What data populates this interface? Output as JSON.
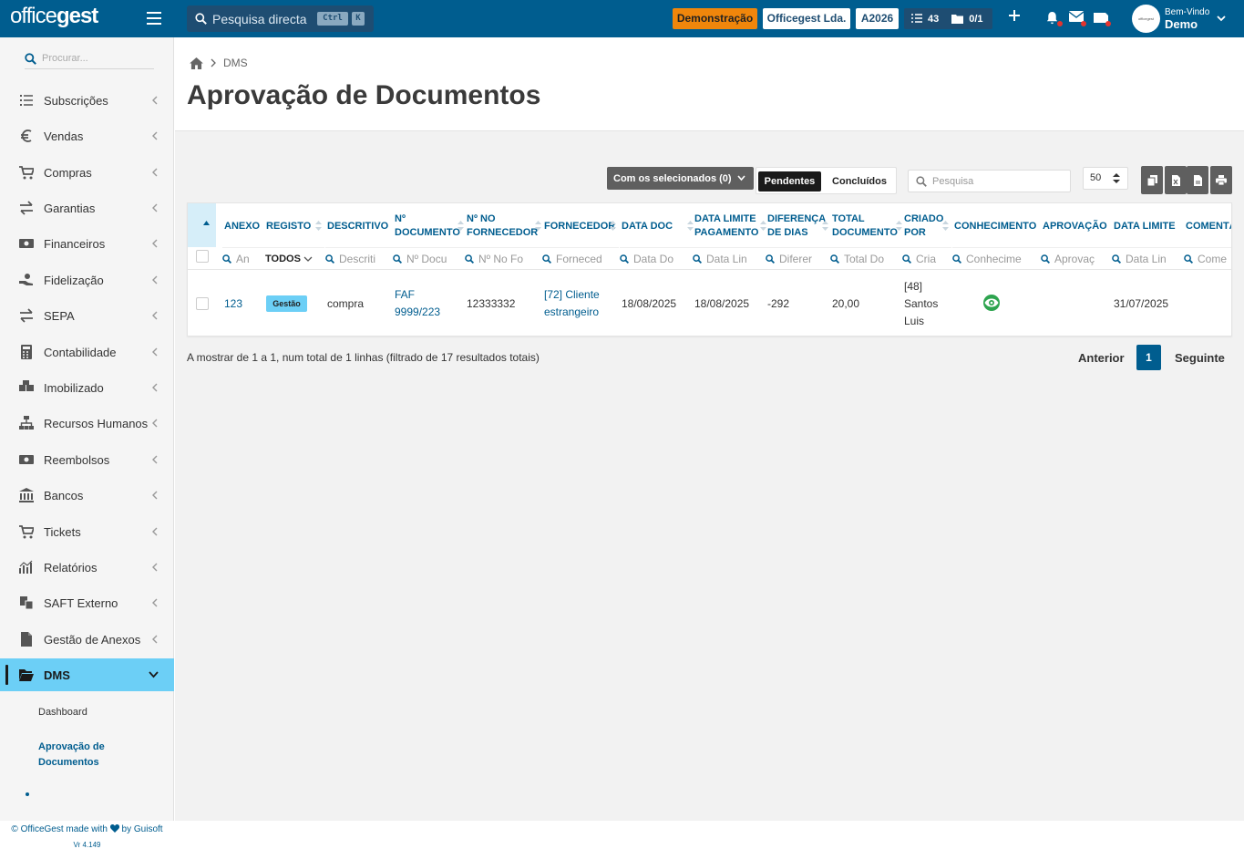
{
  "app": {
    "logo_prefix": "office",
    "logo_suffix": "gest"
  },
  "topbar": {
    "search_label": "Pesquisa directa",
    "kbd_ctrl": "Ctrl",
    "kbd_k": "K",
    "badge_demo": "Demonstração",
    "badge_company": "Officegest Lda.",
    "badge_year": "A2026",
    "tasks_count": "43",
    "folders_count": "0/1",
    "welcome": "Bem-Vindo",
    "user": "Demo",
    "colors": {
      "bar": "#005d8f",
      "demo_badge": "#f0860b",
      "notif_dot": "#e3342f"
    }
  },
  "sidebar": {
    "search_placeholder": "Procurar...",
    "items": [
      {
        "label": "Subscrições",
        "icon": "list-icon"
      },
      {
        "label": "Vendas",
        "icon": "euro-icon"
      },
      {
        "label": "Compras",
        "icon": "cart-icon"
      },
      {
        "label": "Garantias",
        "icon": "exchange-icon"
      },
      {
        "label": "Financeiros",
        "icon": "money-icon"
      },
      {
        "label": "Fidelização",
        "icon": "hand-coin-icon"
      },
      {
        "label": "SEPA",
        "icon": "exchange-icon"
      },
      {
        "label": "Contabilidade",
        "icon": "calculator-icon"
      },
      {
        "label": "Imobilizado",
        "icon": "boxes-icon"
      },
      {
        "label": "Recursos Humanos",
        "icon": "org-chart-icon"
      },
      {
        "label": "Reembolsos",
        "icon": "money-icon"
      },
      {
        "label": "Bancos",
        "icon": "bank-icon"
      },
      {
        "label": "Tickets",
        "icon": "cart-icon"
      },
      {
        "label": "Relatórios",
        "icon": "chart-icon"
      },
      {
        "label": "SAFT Externo",
        "icon": "saft-icon"
      },
      {
        "label": "Gestão de Anexos",
        "icon": "file-icon"
      },
      {
        "label": "DMS",
        "icon": "folder-open-icon"
      }
    ],
    "sub_items": [
      "Dashboard",
      "Aprovação de",
      "Documentos"
    ],
    "footer_prefix": "© OfficeGest made with",
    "footer_suffix": "by Guisoft",
    "version": "Vr 4.149",
    "active_color": "#6ccff6"
  },
  "page": {
    "breadcrumb": "DMS",
    "title": "Aprovação de Documentos"
  },
  "toolbar": {
    "bulk_label": "Com os selecionados (0)",
    "tab_pending": "Pendentes",
    "tab_done": "Concluídos",
    "search_placeholder": "Pesquisa",
    "page_size": "50"
  },
  "table": {
    "headers": [
      {
        "l1": "ANEXO",
        "l2": ""
      },
      {
        "l1": "REGISTO",
        "l2": ""
      },
      {
        "l1": "DESCRITIVO",
        "l2": ""
      },
      {
        "l1": "Nº",
        "l2": "DOCUMENTO"
      },
      {
        "l1": "Nº NO",
        "l2": "FORNECEDOR"
      },
      {
        "l1": "FORNECEDOR",
        "l2": ""
      },
      {
        "l1": "DATA DOC",
        "l2": ""
      },
      {
        "l1": "DATA LIMITE",
        "l2": "PAGAMENTO"
      },
      {
        "l1": "DIFERENÇA",
        "l2": "DE DIAS"
      },
      {
        "l1": "TOTAL",
        "l2": "DOCUMENTO"
      },
      {
        "l1": "CRIADO",
        "l2": "POR"
      },
      {
        "l1": "CONHECIMENTO",
        "l2": ""
      },
      {
        "l1": "APROVAÇÃO",
        "l2": ""
      },
      {
        "l1": "DATA LIMITE",
        "l2": ""
      },
      {
        "l1": "COMENTÁ",
        "l2": ""
      }
    ],
    "filters": [
      "An",
      "TODOS",
      "Descriti",
      "Nº Docu",
      "Nº No Fo",
      "Forneced",
      "Data Do",
      "Data Lin",
      "Diferer",
      "Total Do",
      "Cria",
      "Conhecime",
      "Aprovaç",
      "Data Lin",
      "Come"
    ],
    "row": {
      "anexo": "123",
      "registo": "Gestão",
      "descritivo": "compra",
      "doc_l1": "FAF",
      "doc_l2": "9999/223",
      "n_fornecedor": "12333332",
      "fornecedor_l1": "[72] Cliente",
      "fornecedor_l2": "estrangeiro",
      "data_doc": "18/08/2025",
      "data_limite_pag": "18/08/2025",
      "diferenca": "-292",
      "total": "20,00",
      "criado_l1": "[48]",
      "criado_l2": "Santos",
      "criado_l3": "Luis",
      "data_limite": "31/07/2025"
    }
  },
  "footer": {
    "info": "A mostrar de 1 a 1, num total de 1 linhas (filtrado de 17 resultados totais)",
    "prev": "Anterior",
    "page": "1",
    "next": "Seguinte"
  }
}
